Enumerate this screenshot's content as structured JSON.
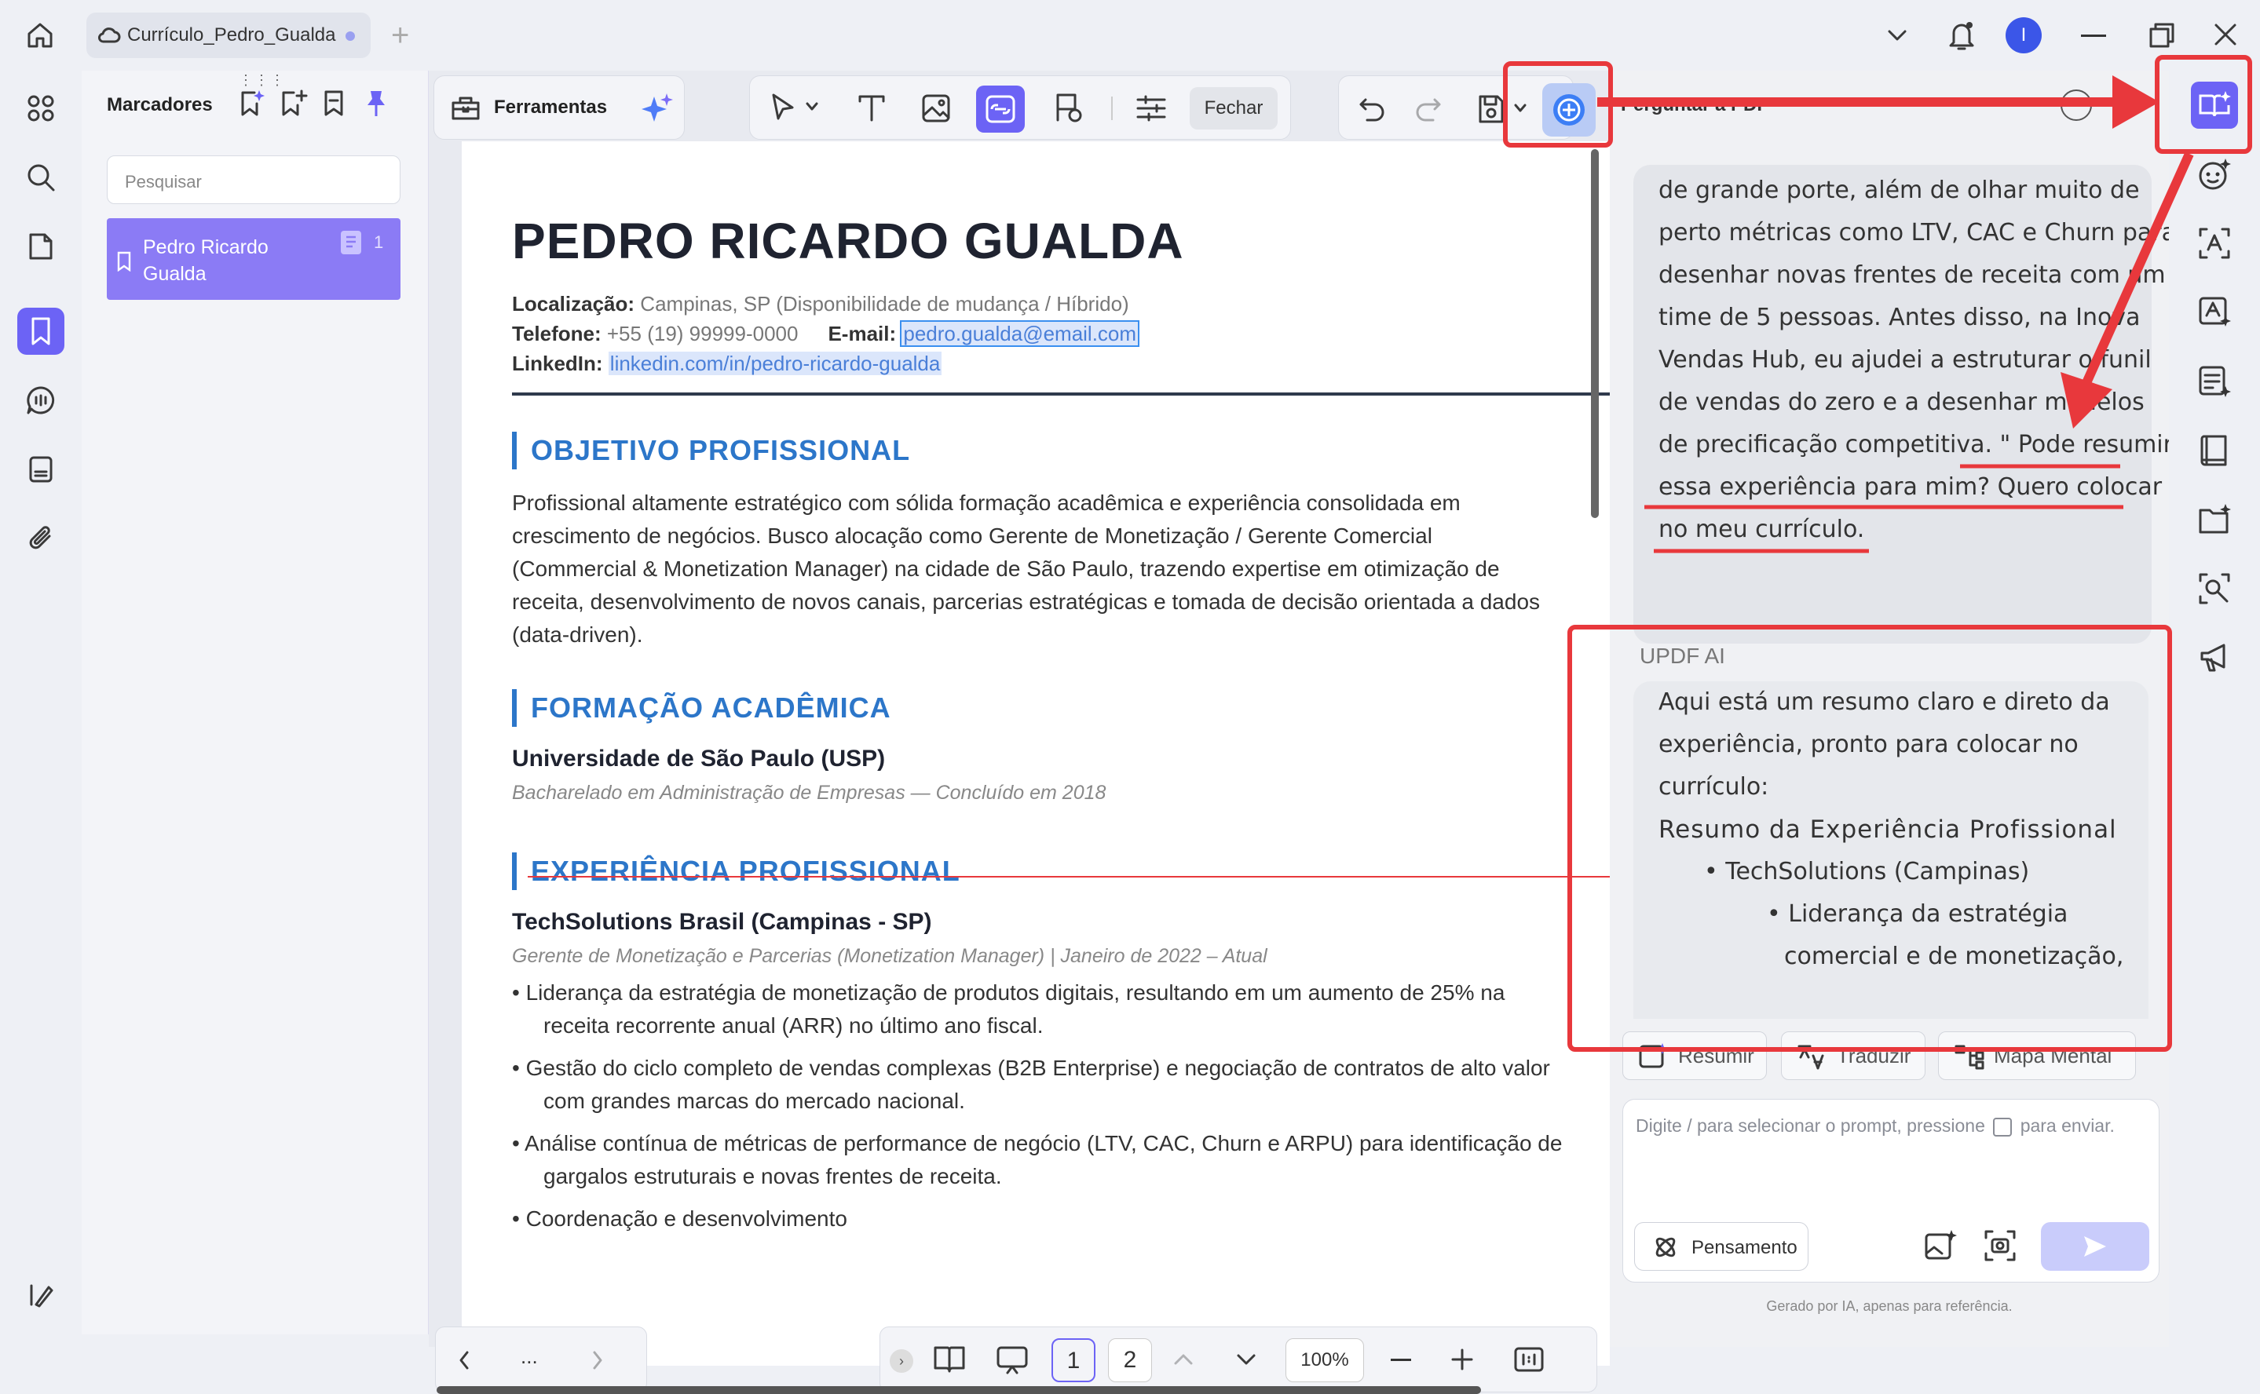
{
  "tab": {
    "title": "Currículo_Pedro_Gualda"
  },
  "bookmarks": {
    "title": "Marcadores",
    "search_placeholder": "Pesquisar",
    "items": [
      {
        "label": "Pedro Ricardo Gualda",
        "count": "1"
      }
    ]
  },
  "toolbar": {
    "tools_label": "Ferramentas",
    "close_label": "Fechar",
    "ask_pdf_label": "Perguntar a PDF"
  },
  "doc": {
    "name": "PEDRO RICARDO GUALDA",
    "location_label": "Localização:",
    "location_value": "Campinas, SP (Disponibilidade de mudança / Híbrido)",
    "phone_label": "Telefone:",
    "phone_value": "+55 (19) 99999-0000",
    "email_label": "E-mail:",
    "email_value": "pedro.gualda@email.com",
    "linkedin_label": "LinkedIn:",
    "linkedin_value": "linkedin.com/in/pedro-ricardo-gualda",
    "objective_heading": "OBJETIVO PROFISSIONAL",
    "objective_lines": [
      "Profissional altamente estratégico com sólida formação acadêmica e experiência consolidada em",
      "crescimento de negócios. Busco alocação como Gerente de Monetização / Gerente Comercial",
      "(Commercial & Monetization Manager) na cidade de São Paulo, trazendo expertise em otimização de",
      "receita, desenvolvimento de novos canais, parcerias estratégicas e tomada de decisão orientada a dados",
      "(data-driven)."
    ],
    "education_heading": "FORMAÇÃO ACADÊMICA",
    "university": "Universidade de São Paulo (USP)",
    "degree": "Bacharelado em Administração de Empresas — Concluído em 2018",
    "experience_heading": "EXPERIÊNCIA PROFISSIONAL",
    "company": "TechSolutions Brasil (Campinas - SP)",
    "role": "Gerente de Monetização e Parcerias (Monetization Manager) | Janeiro de 2022 – Atual",
    "bullets": [
      [
        "Liderança da estratégia de monetização de produtos digitais, resultando em um aumento de 25% na",
        "receita recorrente anual (ARR) no último ano fiscal."
      ],
      [
        "Gestão do ciclo completo de vendas complexas (B2B Enterprise) e negociação de contratos de alto valor",
        "com grandes marcas do mercado nacional."
      ],
      [
        "Análise contínua de métricas de performance de negócio (LTV, CAC, Churn e ARPU) para identificação de",
        "gargalos estruturais e novas frentes de receita."
      ],
      [
        "Coordenação e desenvolvimento",
        ""
      ]
    ]
  },
  "nav": {
    "page1": "1",
    "page2": "2",
    "zoom": "100%",
    "more": "..."
  },
  "ai": {
    "user_lines": [
      "de grande porte, além de olhar muito de",
      "perto métricas como LTV, CAC e Churn para",
      "desenhar novas frentes de receita com um",
      "time de 5 pessoas. Antes disso, na Inova",
      "Vendas Hub, eu ajudei a estruturar o funil",
      "de vendas do zero e a desenhar modelos",
      "de precificação competitiva. \" Pode resumir",
      "essa experiência para mim? Quero colocar",
      "no meu currículo."
    ],
    "assistant_name": "UPDF AI",
    "reply_intro": [
      "Aqui está um resumo claro e direto da",
      "experiência, pronto para colocar no",
      "currículo:"
    ],
    "reply_heading": "Resumo da Experiência Profissional",
    "reply_l1": "• TechSolutions (Campinas)",
    "reply_l2": [
      "• Liderança da estratégia",
      "comercial e de monetização,"
    ],
    "chips": [
      "Resumir",
      "Traduzir",
      "Mapa Mental"
    ],
    "input_placeholder": "Digite / para selecionar o prompt, pressione",
    "input_placeholder_suffix": "para enviar.",
    "thinking_label": "Pensamento",
    "footer": "Gerado por IA, apenas para referência."
  },
  "user": {
    "avatar_initial": "I"
  },
  "colors": {
    "accent": "#6c63f5",
    "heading_blue": "#2c76c9",
    "annotation_red": "#e8383c"
  }
}
